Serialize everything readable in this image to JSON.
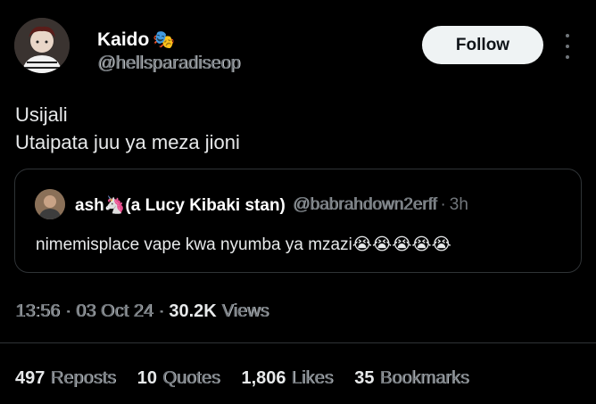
{
  "author": {
    "display_name": "Kaido",
    "name_emoji": "🎭",
    "handle": "@hellsparadiseop"
  },
  "follow_label": "Follow",
  "tweet": {
    "line1": "Usijali",
    "line2": "Utaipata juu ya meza jioni"
  },
  "quote": {
    "name": "ash🦄(a Lucy Kibaki stan)",
    "handle": "@babrahdown2erff",
    "dot": "·",
    "time": "3h",
    "text": "nimemisplace vape kwa nyumba ya mzazi😭😭😭😭😭"
  },
  "meta": {
    "time": "13:56",
    "date": "03 Oct 24",
    "views_count": "30.2K",
    "views_label": "Views",
    "sep": "·"
  },
  "stats": [
    {
      "count": "497",
      "label": "Reposts"
    },
    {
      "count": "10",
      "label": "Quotes"
    },
    {
      "count": "1,806",
      "label": "Likes"
    },
    {
      "count": "35",
      "label": "Bookmarks"
    }
  ]
}
